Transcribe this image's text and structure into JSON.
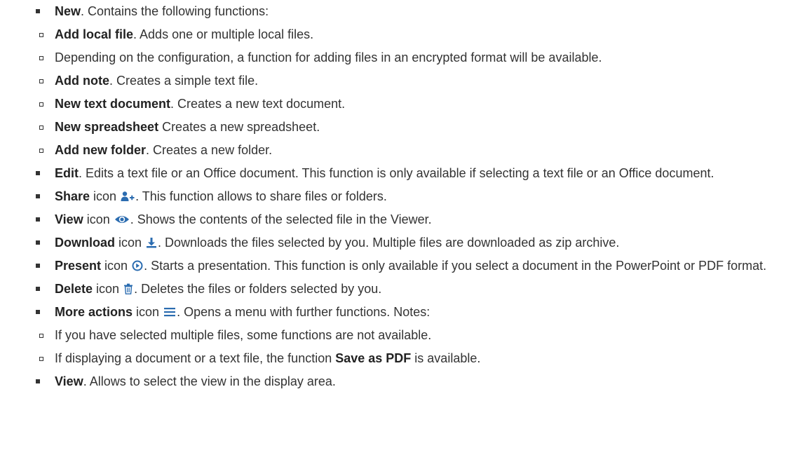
{
  "items": [
    {
      "term": "New",
      "text": ". Contains the following functions:",
      "sub": [
        {
          "term": "Add local file",
          "text": ". Adds one or multiple local files."
        },
        {
          "term": "",
          "text": "Depending on the configuration, a function for adding files in an encrypted format will be available."
        },
        {
          "term": "Add note",
          "text": ". Creates a simple text file."
        },
        {
          "term": "New text document",
          "text": ". Creates a new text document."
        },
        {
          "term": "New spreadsheet",
          "text": " Creates a new spreadsheet."
        },
        {
          "term": "Add new folder",
          "text": ". Creates a new folder."
        }
      ]
    },
    {
      "term": "Edit",
      "text": ". Edits a text file or an Office document. This function is only available if selecting a text file or an Office document."
    },
    {
      "term": "Share",
      "pre_icon": " icon ",
      "icon": "share-user-plus-icon",
      "text": ". This function allows to share files or folders."
    },
    {
      "term": "View",
      "pre_icon": " icon ",
      "icon": "eye-icon",
      "text": ". Shows the contents of the selected file in the Viewer."
    },
    {
      "term": "Download",
      "pre_icon": " icon ",
      "icon": "download-icon",
      "text": ". Downloads the files selected by you. Multiple files are downloaded as zip archive."
    },
    {
      "term": "Present",
      "pre_icon": " icon ",
      "icon": "play-circle-icon",
      "text": ". Starts a presentation. This function is only available if you select a document in the PowerPoint or PDF format."
    },
    {
      "term": "Delete",
      "pre_icon": " icon ",
      "icon": "trash-icon",
      "text": ". Deletes the files or folders selected by you."
    },
    {
      "term": "More actions",
      "pre_icon": " icon ",
      "icon": "hamburger-menu-icon",
      "text": ". Opens a menu with further functions. Notes:",
      "sub": [
        {
          "text": "If you have selected multiple files, some functions are not available."
        },
        {
          "text": "If displaying a document or a text file, the function ",
          "term": "Save as PDF",
          "after": " is available."
        }
      ]
    },
    {
      "term": "View",
      "text": ". Allows to select the view in the display area."
    }
  ],
  "colors": {
    "text": "#333333",
    "icon": "#2b6cb0"
  }
}
